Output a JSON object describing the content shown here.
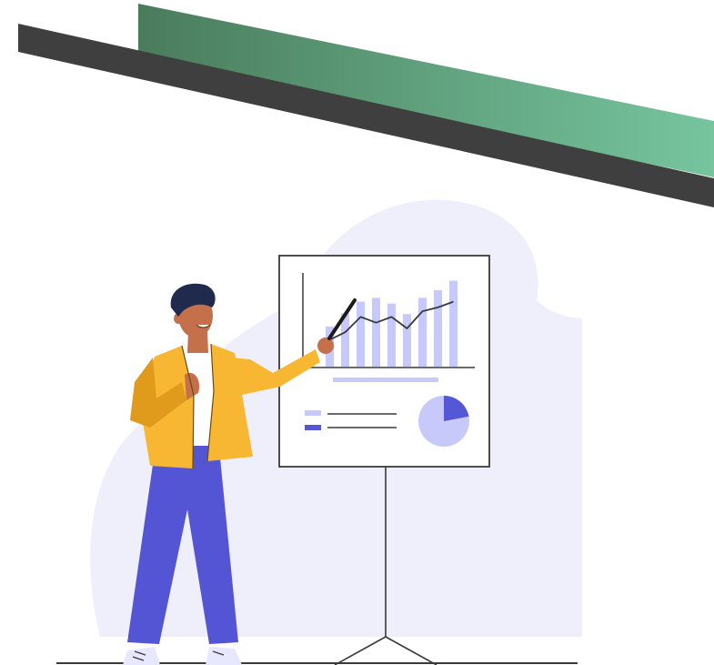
{
  "colors": {
    "band_dark": "#3f3f3f",
    "band_green_start": "#4a7c5c",
    "band_green_end": "#76c59f",
    "blob": "#eeeffb",
    "board_stroke": "#3a3a3a",
    "bar_light": "#c7c9fb",
    "accent_blue": "#5558d6",
    "jacket": "#f7b733",
    "jacket_shadow": "#e09a1c",
    "skin": "#c4704a",
    "hair": "#1f2a4d",
    "pants": "#5455d4",
    "shirt": "#ffffff",
    "shoe": "#e7e7ff"
  },
  "board": {
    "bar_values": [
      0.42,
      0.56,
      0.68,
      0.72,
      0.66,
      0.55,
      0.72,
      0.8,
      0.9
    ],
    "trend_values": [
      0.28,
      0.36,
      0.52,
      0.46,
      0.52,
      0.4,
      0.58,
      0.62,
      0.68
    ],
    "pie_highlight_fraction": 0.22
  },
  "icons": [
    "presentation-board-icon",
    "pointer-stick-icon",
    "pie-chart-icon",
    "legend-icon"
  ]
}
